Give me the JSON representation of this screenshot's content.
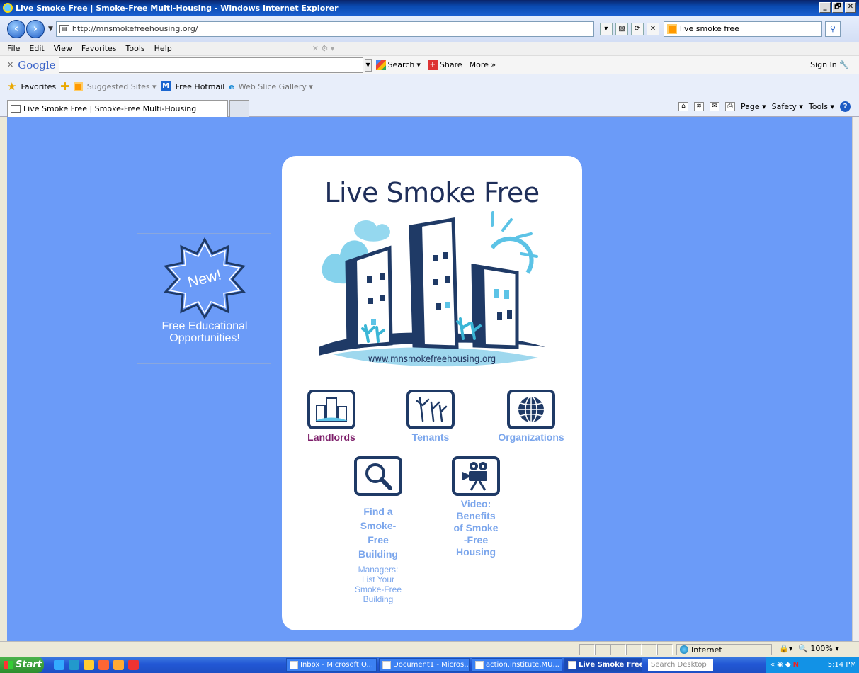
{
  "window": {
    "title": "Live Smoke Free | Smoke-Free Multi-Housing - Windows Internet Explorer",
    "min": "_",
    "max": "🗗",
    "close": "✕"
  },
  "address": {
    "url": "http://mnsmokefreehousing.org/",
    "search_value": "live smoke free"
  },
  "menu": [
    "File",
    "Edit",
    "View",
    "Favorites",
    "Tools",
    "Help"
  ],
  "google_bar": {
    "logo": "Google",
    "search_label": "Search",
    "share_label": "Share",
    "more_label": "More »",
    "signin_label": "Sign In"
  },
  "favorites_bar": {
    "favorites_label": "Favorites",
    "suggested_label": "Suggested Sites ▾",
    "hotmail_label": "Free Hotmail",
    "webslice_label": "Web Slice Gallery ▾"
  },
  "tab": {
    "title": "Live Smoke Free | Smoke-Free Multi-Housing"
  },
  "command_bar": {
    "page_label": "Page ▾",
    "safety_label": "Safety ▾",
    "tools_label": "Tools ▾"
  },
  "page": {
    "promo": {
      "badge": "New!",
      "text_line1": "Free Educational",
      "text_line2": "Opportunities!"
    },
    "title": "Live Smoke Free",
    "site_url": "www.mnsmokefreehousing.org",
    "nav": {
      "landlords": "Landlords",
      "tenants": "Tenants",
      "organizations": "Organizations",
      "find_building": [
        "Find a",
        "Smoke-",
        "Free",
        "Building"
      ],
      "video": [
        "Video:",
        "Benefits",
        "of Smoke",
        "-Free",
        "Housing"
      ]
    },
    "managers_link": [
      "Managers:",
      "List Your",
      "Smoke-Free",
      "Building"
    ],
    "colors": {
      "background": "#6b9bf8",
      "purple_label": "#7d1e6a",
      "blue_label": "#7ba6ec",
      "dark_navy": "#1f3a66"
    }
  },
  "status": {
    "zone": "Internet",
    "zoom": "100%"
  },
  "taskbar": {
    "start": "Start",
    "buttons": [
      "Inbox - Microsoft O...",
      "Document1 - Micros...",
      "action.institute.MU...",
      "Live Smoke Free ..."
    ],
    "search_placeholder": "Search Desktop",
    "clock": "5:14 PM"
  }
}
